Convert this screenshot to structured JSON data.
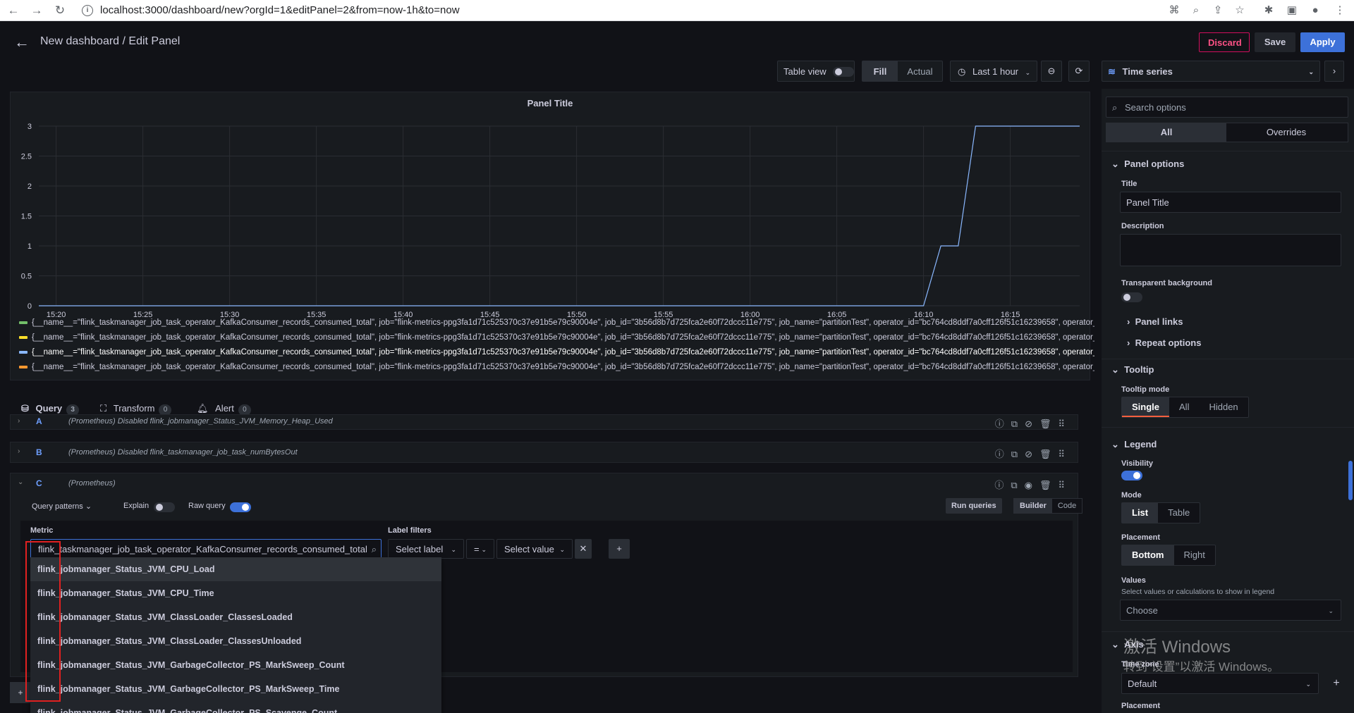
{
  "browser": {
    "url": "localhost:3000/dashboard/new?orgId=1&editPanel=2&from=now-1h&to=now",
    "colors": {
      "bar": "#ffffff"
    }
  },
  "header": {
    "title": "New dashboard / Edit Panel",
    "discard_label": "Discard",
    "save_label": "Save",
    "apply_label": "Apply"
  },
  "toolbar": {
    "table_view_label": "Table view",
    "fill_label": "Fill",
    "actual_label": "Actual",
    "time_range_label": "Last 1 hour",
    "visualization": "Time series"
  },
  "panel": {
    "title": "Panel Title",
    "legend": [
      {
        "color": "#73bf69",
        "text": "{__name__=\"flink_taskmanager_job_task_operator_KafkaConsumer_records_consumed_total\", job=\"flink-metrics-ppg3fa1d71c525370c37e91b5e79c90004e\", job_id=\"3b56d8b7d725fca2e60f72dccc11e775\", job_name=\"partitionTest\", operator_id=\"bc764cd8ddf7a0cff126f51c16239658\", operator_name=\"So"
      },
      {
        "color": "#fade2a",
        "text": "{__name__=\"flink_taskmanager_job_task_operator_KafkaConsumer_records_consumed_total\", job=\"flink-metrics-ppg3fa1d71c525370c37e91b5e79c90004e\", job_id=\"3b56d8b7d725fca2e60f72dccc11e775\", job_name=\"partitionTest\", operator_id=\"bc764cd8ddf7a0cff126f51c16239658\", operator_name=\"So"
      },
      {
        "color": "#8ab8ff",
        "text": "{__name__=\"flink_taskmanager_job_task_operator_KafkaConsumer_records_consumed_total\", job=\"flink-metrics-ppg3fa1d71c525370c37e91b5e79c90004e\", job_id=\"3b56d8b7d725fca2e60f72dccc11e775\", job_name=\"partitionTest\", operator_id=\"bc764cd8ddf7a0cff126f51c16239658\", operator_name=\"So"
      },
      {
        "color": "#ff9830",
        "text": "{__name__=\"flink_taskmanager_job_task_operator_KafkaConsumer_records_consumed_total\", job=\"flink-metrics-ppg3fa1d71c525370c37e91b5e79c90004e\", job_id=\"3b56d8b7d725fca2e60f72dccc11e775\", job_name=\"partitionTest\", operator_id=\"bc764cd8ddf7a0cff126f51c16239658\", operator_name=\"So"
      }
    ]
  },
  "chart_data": {
    "type": "line",
    "title": "Panel Title",
    "x_ticks": [
      "15:20",
      "15:25",
      "15:30",
      "15:35",
      "15:40",
      "15:45",
      "15:50",
      "15:55",
      "16:00",
      "16:05",
      "16:10",
      "16:15"
    ],
    "y_ticks": [
      "0",
      "0.5",
      "1",
      "1.5",
      "2",
      "2.5",
      "3"
    ],
    "ylim": [
      0,
      3
    ],
    "xlim": [
      "15:19",
      "16:19"
    ],
    "grid": true,
    "legend_position": "bottom",
    "series": [
      {
        "color": "#8ab8ff",
        "x": [
          "15:19",
          "16:10",
          "16:11",
          "16:12",
          "16:13",
          "16:19"
        ],
        "y": [
          0,
          0,
          1,
          1,
          3,
          3
        ]
      }
    ]
  },
  "query_tabs": [
    {
      "label": "Query",
      "count": "3"
    },
    {
      "label": "Transform",
      "count": "0"
    },
    {
      "label": "Alert",
      "count": "0"
    }
  ],
  "queries": [
    {
      "letter": "A",
      "desc": "(Prometheus)  Disabled  flink_jobmanager_Status_JVM_Memory_Heap_Used"
    },
    {
      "letter": "B",
      "desc": "(Prometheus)  Disabled  flink_taskmanager_job_task_numBytesOut"
    },
    {
      "letter": "C",
      "desc": "(Prometheus)"
    }
  ],
  "query_c": {
    "query_patterns_label": "Query patterns",
    "explain_label": "Explain",
    "raw_query_label": "Raw query",
    "run_queries_label": "Run queries",
    "builder_label": "Builder",
    "code_label": "Code",
    "metric_label": "Metric",
    "metric_value": "flink_taskmanager_job_task_operator_KafkaConsumer_records_consumed_total",
    "label_filters_label": "Label filters",
    "select_label": "Select label",
    "operator": "=",
    "select_value": "Select value"
  },
  "dropdown_items": [
    "flink_jobmanager_Status_JVM_CPU_Load",
    "flink_jobmanager_Status_JVM_CPU_Time",
    "flink_jobmanager_Status_JVM_ClassLoader_ClassesLoaded",
    "flink_jobmanager_Status_JVM_ClassLoader_ClassesUnloaded",
    "flink_jobmanager_Status_JVM_GarbageCollector_PS_MarkSweep_Count",
    "flink_jobmanager_Status_JVM_GarbageCollector_PS_MarkSweep_Time",
    "flink_jobmanager_Status_JVM_GarbageCollector_PS_Scavenge_Count"
  ],
  "options": {
    "search_placeholder": "Search options",
    "all_label": "All",
    "overrides_label": "Overrides",
    "panel_options": "Panel options",
    "title_label": "Title",
    "title_value": "Panel Title",
    "description_label": "Description",
    "transparent_label": "Transparent background",
    "panel_links": "Panel links",
    "repeat_options": "Repeat options",
    "tooltip": "Tooltip",
    "tooltip_mode_label": "Tooltip mode",
    "tooltip_modes": [
      "Single",
      "All",
      "Hidden"
    ],
    "legend": "Legend",
    "visibility_label": "Visibility",
    "mode_label": "Mode",
    "modes": [
      "List",
      "Table"
    ],
    "placement_label": "Placement",
    "placements": [
      "Bottom",
      "Right"
    ],
    "values_label": "Values",
    "values_help": "Select values or calculations to show in legend",
    "values_choose": "Choose",
    "axis": "Axis",
    "timezone_label": "Time zone",
    "timezone_value": "Default",
    "placement2_label": "Placement"
  },
  "watermark": {
    "line1": "激活 Windows",
    "line2": "转到“设置”以激活 Windows。"
  }
}
